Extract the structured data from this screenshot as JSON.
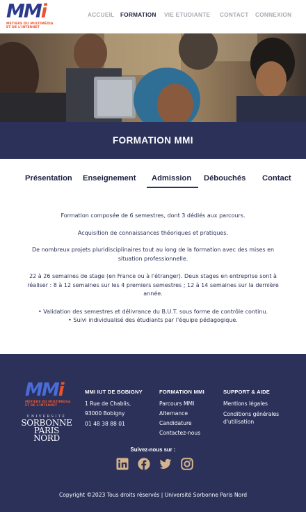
{
  "header": {
    "logo": {
      "title": "MMi",
      "line1": "MÉTIERS DU MULTIMÉDIA",
      "line2": "ET DE L'INTERNET"
    },
    "nav": [
      {
        "label": "ACCUEIL",
        "active": false
      },
      {
        "label": "FORMATION",
        "active": true
      },
      {
        "label": "VIE ETUDIANTE",
        "active": false
      },
      {
        "label": "CONTACT",
        "active": false
      },
      {
        "label": "CONNEXION",
        "active": false
      }
    ]
  },
  "hero": {
    "alt": ""
  },
  "band": {
    "title": "FORMATION MMI"
  },
  "tabs": [
    {
      "label": "Présentation",
      "active": false
    },
    {
      "label": "Enseignement",
      "active": false
    },
    {
      "label": "Admission",
      "active": true
    },
    {
      "label": "Débouchés",
      "active": false
    },
    {
      "label": "Contact",
      "active": false
    }
  ],
  "content": {
    "paragraphs": [
      "Formation composée de 6 semestres, dont 3 dédiés aux parcours.",
      "Acquisition de connaissances théoriques et pratiques.",
      "De nombreux projets pluridisciplinaires tout au long de la formation avec des mises en situation professionnelle.",
      "22 à 26 semaines de stage (en France ou à l'étranger). Deux stages en entreprise sont à réaliser : 8 à 12 semaines sur les 4 premiers semestres ; 12 à 14 semaines sur la dernière année.",
      "• Validation des semestres et délivrance du B.U.T. sous forme de contrôle continu.",
      "• Suivi individualisé des étudiants par l'équipe pédagogique."
    ]
  },
  "footer": {
    "logo": {
      "title": "MMi",
      "line1": "MÉTIERS DU MULTIMÉDIA",
      "line2": "ET DE L'INTERNET"
    },
    "university": {
      "top": "UNIVERSITÉ",
      "name1": "SORBONNE",
      "name2": "PARIS NORD"
    },
    "col1": {
      "title": "MMI IUT DE BOBIGNY",
      "lines": [
        "1 Rue de Chablis,",
        "93000 Bobigny",
        "01 48 38 88 01"
      ]
    },
    "col2": {
      "title": "FORMATION MMI",
      "links": [
        "Parcours MMI",
        "Alternance",
        "Candidature",
        "Contactez-nous"
      ]
    },
    "col3": {
      "title": "SUPPORT & AIDE",
      "links": [
        "Mentions légales",
        "Conditions générales d'utilisation"
      ]
    },
    "follow": "Suivez-nous sur :",
    "socials": [
      "linkedin-icon",
      "facebook-icon",
      "twitter-icon",
      "instagram-icon"
    ],
    "social_color": "#d4b48c",
    "copyright": "Copyright ©2023 Tous droits réservés | Université Sorbonne Paris Nord"
  },
  "colors": {
    "navy": "#2b3159",
    "accent": "#e8542b",
    "nav_muted": "#a9a9b3"
  }
}
